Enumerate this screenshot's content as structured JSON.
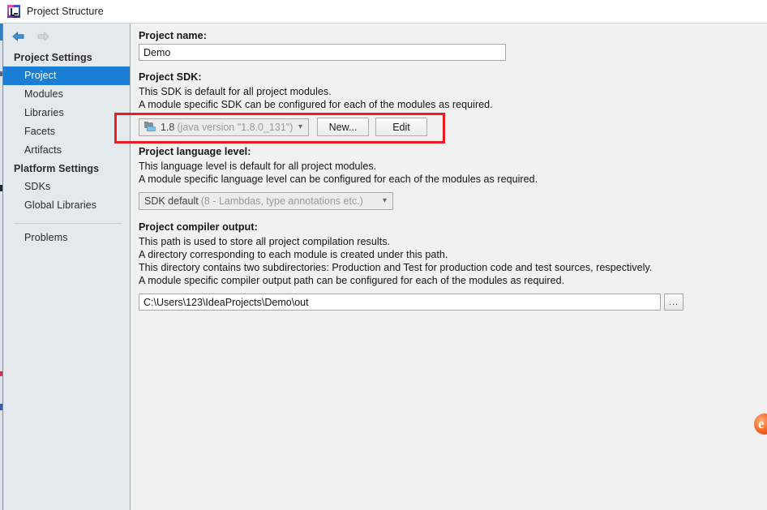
{
  "window": {
    "title": "Project Structure",
    "app_icon": "intellij-idea-icon"
  },
  "nav": {
    "back_icon": "arrow-left-icon",
    "forward_icon": "arrow-right-icon"
  },
  "sidebar": {
    "sections": [
      {
        "heading": "Project Settings",
        "items": [
          {
            "label": "Project",
            "selected": true
          },
          {
            "label": "Modules",
            "selected": false
          },
          {
            "label": "Libraries",
            "selected": false
          },
          {
            "label": "Facets",
            "selected": false
          },
          {
            "label": "Artifacts",
            "selected": false
          }
        ]
      },
      {
        "heading": "Platform Settings",
        "items": [
          {
            "label": "SDKs",
            "selected": false
          },
          {
            "label": "Global Libraries",
            "selected": false
          }
        ]
      }
    ],
    "standalone": {
      "label": "Problems"
    }
  },
  "main": {
    "project_name": {
      "label": "Project name:",
      "value": "Demo",
      "placeholder": ""
    },
    "project_sdk": {
      "label": "Project SDK:",
      "description_lines": [
        "This SDK is default for all project modules.",
        "A module specific SDK can be configured for each of the modules as required."
      ],
      "combo": {
        "icon": "jdk-icon",
        "value_strong": "1.8",
        "value_dim": "(java version \"1.8.0_131\")",
        "chevron": "chevron-down-icon"
      },
      "new_button": "New...",
      "edit_button": "Edit"
    },
    "language_level": {
      "label": "Project language level:",
      "description_lines": [
        "This language level is default for all project modules.",
        "A module specific language level can be configured for each of the modules as required."
      ],
      "combo": {
        "value_strong": "SDK default",
        "value_dim": "(8 - Lambdas, type annotations etc.)",
        "chevron": "chevron-down-icon"
      }
    },
    "compiler_output": {
      "label": "Project compiler output:",
      "description_lines": [
        "This path is used to store all project compilation results.",
        "A directory corresponding to each module is created under this path.",
        "This directory contains two subdirectories: Production and Test for production code and test sources, respectively.",
        "A module specific compiler output path can be configured for each of the modules as required."
      ],
      "value": "C:\\Users\\123\\IdeaProjects\\Demo\\out",
      "browse_button": "..."
    }
  },
  "annotation": {
    "highlight_color": "#ec1c24",
    "target": "project-sdk-row"
  },
  "corner_badge": {
    "glyph": "e",
    "color": "#f5692a"
  },
  "colors": {
    "sidebar_bg": "#e3e9ec",
    "main_bg": "#f1f1f1",
    "selection_blue": "#1a7fd4",
    "titlebar_bg": "#ffffff"
  }
}
